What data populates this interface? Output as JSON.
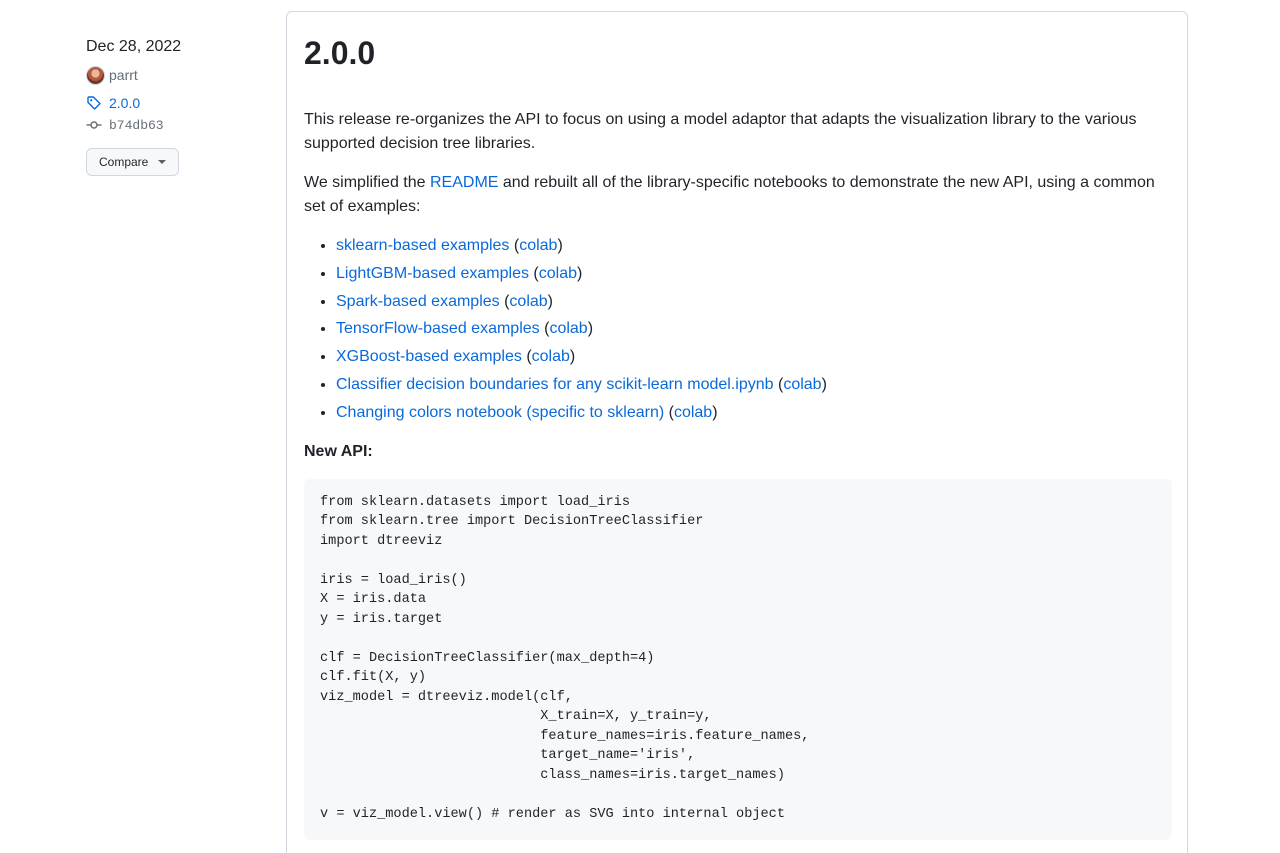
{
  "sidebar": {
    "date": "Dec 28, 2022",
    "author": "parrt",
    "tag": "2.0.0",
    "commit": "b74db63",
    "compare_label": "Compare"
  },
  "release": {
    "title": "2.0.0",
    "intro": "This release re-organizes the API to focus on using a model adaptor that adapts the visualization library to the various supported decision tree libraries.",
    "simplified": {
      "before": "We simplified the ",
      "link": "README",
      "after": " and rebuilt all of the library-specific notebooks to demonstrate the new API, using a common set of examples:"
    },
    "examples": [
      {
        "label": "sklearn-based examples",
        "colab": "colab"
      },
      {
        "label": "LightGBM-based examples",
        "colab": "colab"
      },
      {
        "label": "Spark-based examples",
        "colab": "colab"
      },
      {
        "label": "TensorFlow-based examples",
        "colab": "colab"
      },
      {
        "label": "XGBoost-based examples",
        "colab": "colab"
      },
      {
        "label": "Classifier decision boundaries for any scikit-learn model.ipynb",
        "colab": "colab"
      },
      {
        "label": "Changing colors notebook (specific to sklearn)",
        "colab": "colab"
      }
    ],
    "paren_open": " (",
    "paren_close": ")",
    "new_api_label": "New API:",
    "code": "from sklearn.datasets import load_iris\nfrom sklearn.tree import DecisionTreeClassifier\nimport dtreeviz\n\niris = load_iris()\nX = iris.data\ny = iris.target\n\nclf = DecisionTreeClassifier(max_depth=4)\nclf.fit(X, y)\nviz_model = dtreeviz.model(clf,\n                           X_train=X, y_train=y,\n                           feature_names=iris.feature_names,\n                           target_name='iris',\n                           class_names=iris.target_names)\n\nv = viz_model.view() # render as SVG into internal object"
  },
  "colors": {
    "link": "#0969da",
    "muted": "#656d76",
    "border": "#d0d7de",
    "code_bg": "#f6f8fa"
  }
}
